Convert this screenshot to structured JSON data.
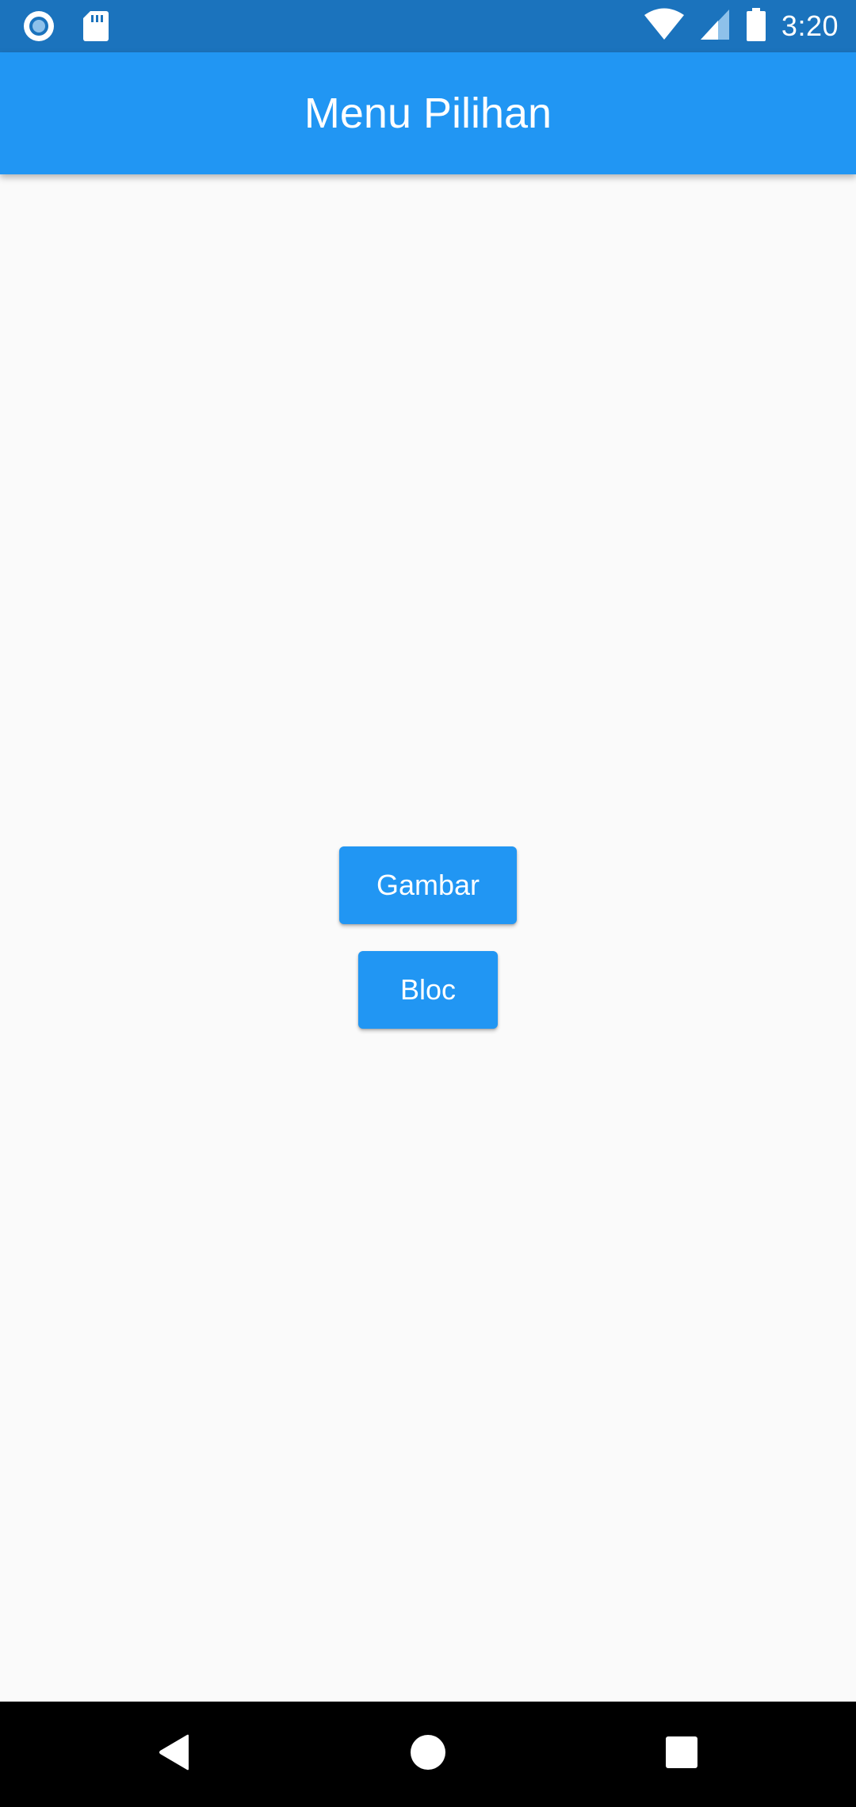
{
  "status_bar": {
    "time": "3:20",
    "icons": [
      "sync-icon",
      "sd-card-icon",
      "wifi-icon",
      "cell-signal-icon",
      "battery-icon"
    ]
  },
  "app_bar": {
    "title": "Menu Pilihan"
  },
  "buttons": {
    "gambar": "Gambar",
    "bloc": "Bloc"
  },
  "nav_bar": {
    "icons": [
      "back-icon",
      "home-icon",
      "recents-icon"
    ]
  },
  "colors": {
    "status_bar": "#1b73bd",
    "app_bar": "#2196f3",
    "button": "#2196f3",
    "background": "#fafafa",
    "nav_bar": "#000000"
  }
}
